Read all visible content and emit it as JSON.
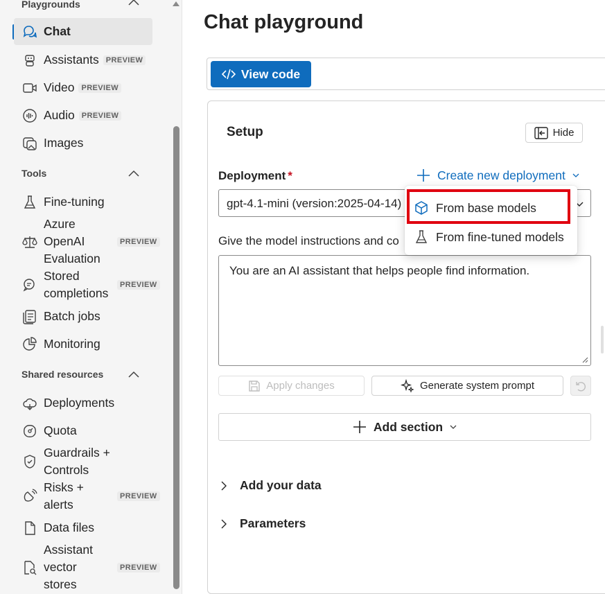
{
  "sidebar": {
    "playgrounds_header": "Playgrounds",
    "playground_items": [
      {
        "label": "Chat",
        "badge": ""
      },
      {
        "label": "Assistants",
        "badge": "PREVIEW"
      },
      {
        "label": "Video",
        "badge": "PREVIEW"
      },
      {
        "label": "Audio",
        "badge": "PREVIEW"
      },
      {
        "label": "Images",
        "badge": ""
      }
    ],
    "tools_header": "Tools",
    "tools_items": [
      {
        "label": "Fine-tuning",
        "badge": ""
      },
      {
        "label_lines": [
          "Azure",
          "OpenAI",
          "Evaluation"
        ],
        "badge": "PREVIEW"
      },
      {
        "label_lines": [
          "Stored",
          "completions"
        ],
        "badge": "PREVIEW"
      },
      {
        "label": "Batch jobs",
        "badge": ""
      },
      {
        "label": "Monitoring",
        "badge": ""
      }
    ],
    "shared_header": "Shared resources",
    "shared_items": [
      {
        "label": "Deployments",
        "badge": ""
      },
      {
        "label": "Quota",
        "badge": ""
      },
      {
        "label_lines": [
          "Guardrails +",
          "Controls"
        ],
        "badge": ""
      },
      {
        "label_lines": [
          "Risks +",
          "alerts"
        ],
        "badge": "PREVIEW"
      },
      {
        "label": "Data files",
        "badge": ""
      },
      {
        "label_lines": [
          "Assistant",
          "vector",
          "stores"
        ],
        "badge": "PREVIEW"
      }
    ]
  },
  "main": {
    "title": "Chat playground",
    "view_code_label": "View code",
    "setup": {
      "title": "Setup",
      "hide_label": "Hide",
      "deployment_label": "Deployment",
      "required_marker": "*",
      "create_deployment_label": "Create new deployment",
      "deployment_value": "gpt-4.1-mini (version:2025-04-14)",
      "instructions_label": "Give the model instructions and co",
      "system_message": "You are an AI assistant that helps people find information.",
      "apply_label": "Apply changes",
      "generate_label": "Generate system prompt",
      "add_section_label": "Add section",
      "add_data_label": "Add your data",
      "parameters_label": "Parameters"
    }
  },
  "dropdown": {
    "items": [
      {
        "label": "From base models",
        "highlighted": true
      },
      {
        "label": "From fine-tuned models",
        "highlighted": false
      }
    ]
  },
  "colors": {
    "accent": "#0f6cbd",
    "highlight_box": "#e00010",
    "required": "#c50f1f"
  }
}
